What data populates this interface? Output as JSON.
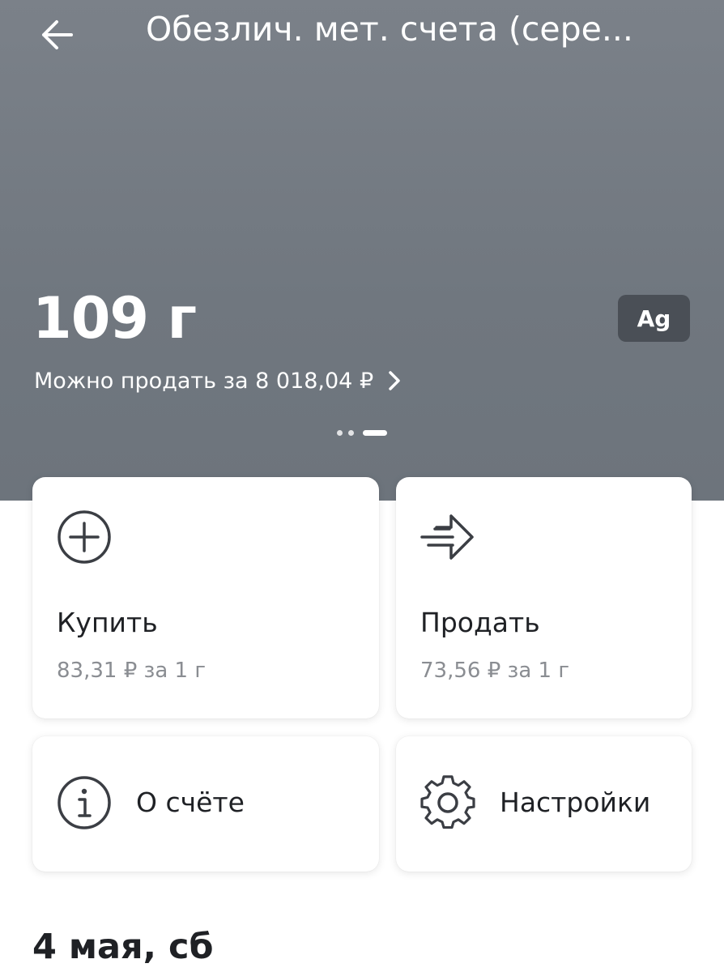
{
  "header": {
    "title": "Обезлич. мет. счета (сере...",
    "balance": "109 г",
    "metal_code": "Ag",
    "sell_link": "Можно продать за 8 018,04 ₽"
  },
  "actions": {
    "buy": {
      "label": "Купить",
      "price": "83,31 ₽ за 1 г"
    },
    "sell": {
      "label": "Продать",
      "price": "73,56 ₽ за 1 г"
    },
    "about": {
      "label": "О счёте"
    },
    "settings": {
      "label": "Настройки"
    }
  },
  "history": {
    "date_heading": "4 мая, сб"
  },
  "icons": {
    "back": "arrow-left-icon",
    "sell_chevron": "chevron-right-icon",
    "buy": "plus-circle-icon",
    "sell": "arrow-send-icon",
    "about": "info-circle-icon",
    "settings": "gear-icon"
  },
  "colors": {
    "header_bg": "#737a82",
    "badge_bg": "#4a4f56",
    "text_primary": "#1f2125",
    "text_secondary": "#8a8d92"
  },
  "pager": {
    "count": 3,
    "active_index": 2
  }
}
